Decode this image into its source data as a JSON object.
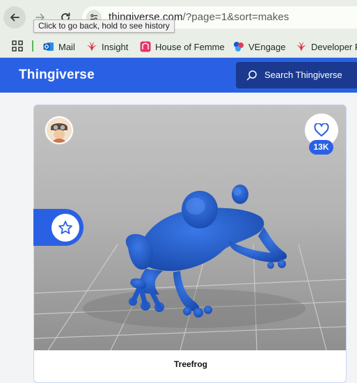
{
  "browser": {
    "url_host": "thingiverse.com",
    "url_path": "/?page=1&sort=makes",
    "tooltip": "Click to go back, hold to see history",
    "bookmarks": [
      {
        "label": "Mail",
        "icon": "outlook-icon"
      },
      {
        "label": "Insight",
        "icon": "insight-icon"
      },
      {
        "label": "House of Femme",
        "icon": "house-of-femme-icon"
      },
      {
        "label": "VEngage",
        "icon": "vengage-icon"
      },
      {
        "label": "Developer P",
        "icon": "developer-icon"
      }
    ]
  },
  "header": {
    "brand": "Thingiverse",
    "search_label": "Search Thingiverse"
  },
  "card": {
    "title": "Treefrog",
    "like_count": "13K"
  },
  "colors": {
    "brand_blue": "#2a61e4",
    "search_bg": "#1b3a8f",
    "model_blue": "#1f57c8"
  }
}
